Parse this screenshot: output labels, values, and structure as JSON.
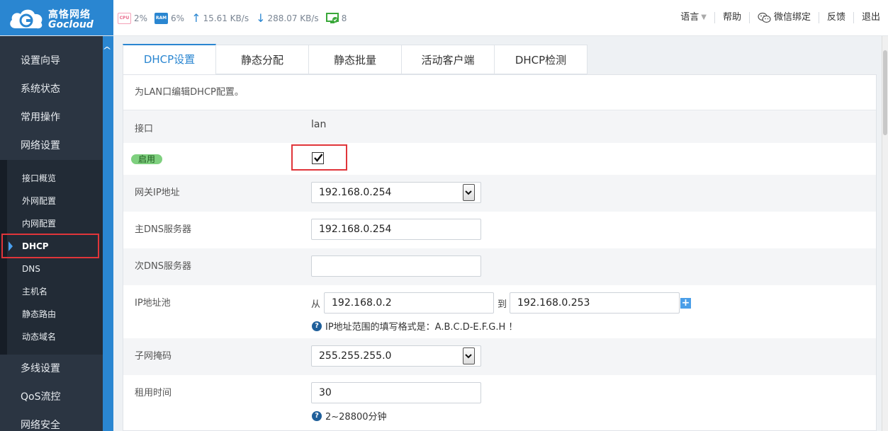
{
  "brand": {
    "name_cn": "高恪网络",
    "name_en": "Gocloud"
  },
  "status": {
    "cpu_chip": "CPU",
    "cpu": "2%",
    "ram_chip": "RAM",
    "ram": "6%",
    "upload": "15.61 KB/s",
    "download": "288.07 KB/s",
    "clients": "8"
  },
  "topnav": {
    "language": "语言",
    "help": "帮助",
    "wechat": "微信绑定",
    "feedback": "反馈",
    "logout": "退出"
  },
  "sidebar": {
    "main_top": [
      "设置向导",
      "系统状态",
      "常用操作",
      "网络设置"
    ],
    "sub": [
      "接口概览",
      "外网配置",
      "内网配置",
      "DHCP",
      "DNS",
      "主机名",
      "静态路由",
      "动态域名"
    ],
    "main_bottom": [
      "多线设置",
      "QoS流控",
      "网络安全"
    ]
  },
  "tabs": [
    "DHCP设置",
    "静态分配",
    "静态批量",
    "活动客户端",
    "DHCP检测"
  ],
  "form": {
    "description": "为LAN口编辑DHCP配置。",
    "interface_label": "接口",
    "interface_value": "lan",
    "enable_label": "启用",
    "gateway_label": "网关IP地址",
    "gateway_value": "192.168.0.254",
    "dns1_label": "主DNS服务器",
    "dns1_value": "192.168.0.254",
    "dns2_label": "次DNS服务器",
    "dns2_value": "",
    "pool_label": "IP地址池",
    "pool_from_label": "从",
    "pool_from": "192.168.0.2",
    "pool_to_label": "到",
    "pool_to": "192.168.0.253",
    "pool_hint": "IP地址范围的填写格式是：A.B.C.D-E.F.G.H ！",
    "mask_label": "子网掩码",
    "mask_value": "255.255.255.0",
    "lease_label": "租用时间",
    "lease_value": "30",
    "lease_hint": "2~28800分钟",
    "help_glyph": "?",
    "plus_glyph": "+"
  },
  "colors": {
    "accent": "#2a86d1",
    "sidebar_bg": "#2b3542",
    "highlight": "#e0353a",
    "badge": "#7fd07f"
  }
}
